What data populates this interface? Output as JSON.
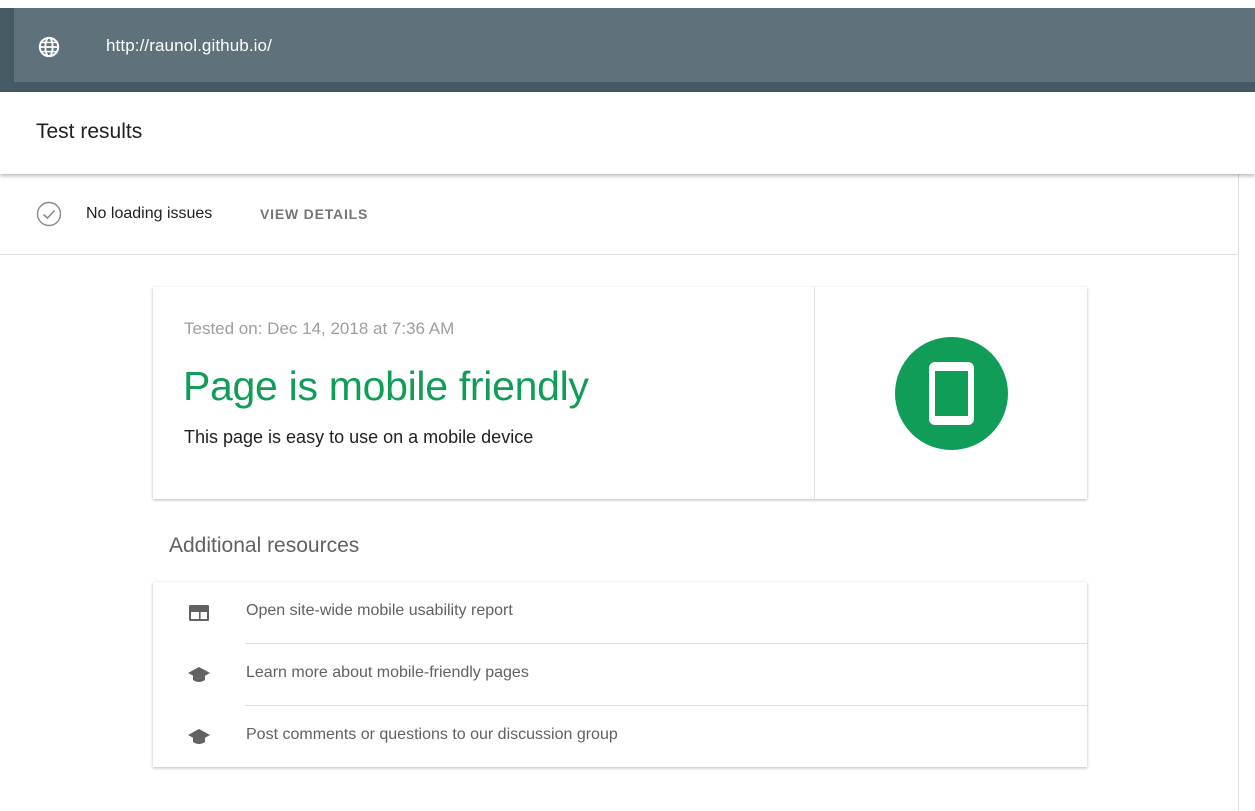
{
  "url_bar": {
    "url": "http://raunol.github.io/",
    "icon": "globe-icon"
  },
  "header": {
    "title": "Test results"
  },
  "loading": {
    "icon": "check-circle-icon",
    "status": "No loading issues",
    "details_label": "VIEW DETAILS"
  },
  "result": {
    "tested_on": "Tested on: Dec 14, 2018 at 7:36 AM",
    "headline": "Page is mobile friendly",
    "subline": "This page is easy to use on a mobile device",
    "icon": "mobile-phone-icon",
    "accent_color": "#0f9d58"
  },
  "resources": {
    "title": "Additional resources",
    "items": [
      {
        "label": "Open site-wide mobile usability report",
        "icon": "report-icon"
      },
      {
        "label": "Learn more about mobile-friendly pages",
        "icon": "school-icon"
      },
      {
        "label": "Post comments or questions to our discussion group",
        "icon": "school-icon"
      }
    ]
  }
}
